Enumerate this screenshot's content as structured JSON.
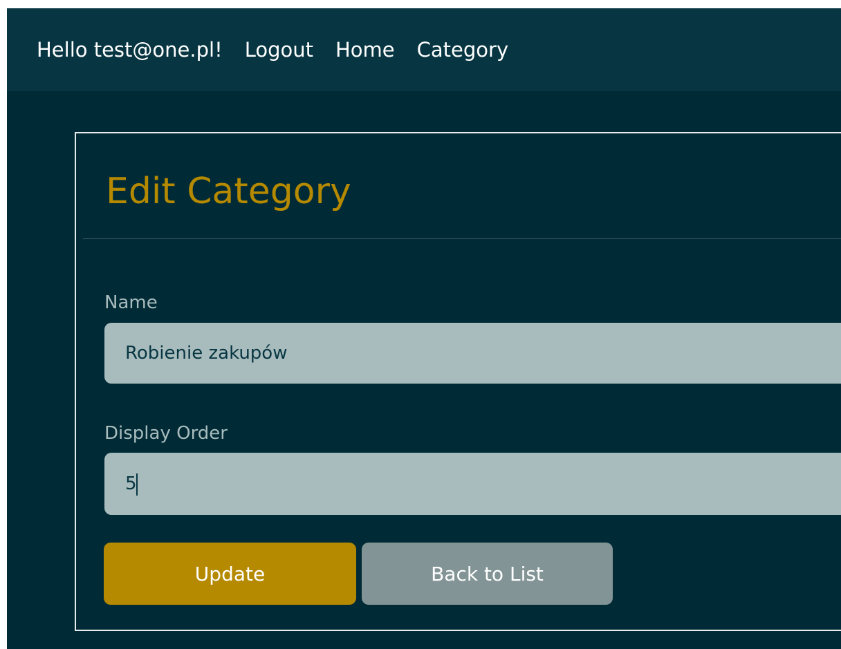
{
  "navbar": {
    "greeting": "Hello test@one.pl!",
    "links": [
      "Logout",
      "Home",
      "Category"
    ]
  },
  "form": {
    "title": "Edit Category",
    "name_label": "Name",
    "name_value": "Robienie zakupów",
    "order_label": "Display Order",
    "order_value": "5",
    "update_label": "Update",
    "back_label": "Back to List"
  },
  "colors": {
    "background": "#002b36",
    "navbar": "#073642",
    "accent": "#b58900",
    "input": "#a9bcbd",
    "secondary_button": "#839496"
  }
}
